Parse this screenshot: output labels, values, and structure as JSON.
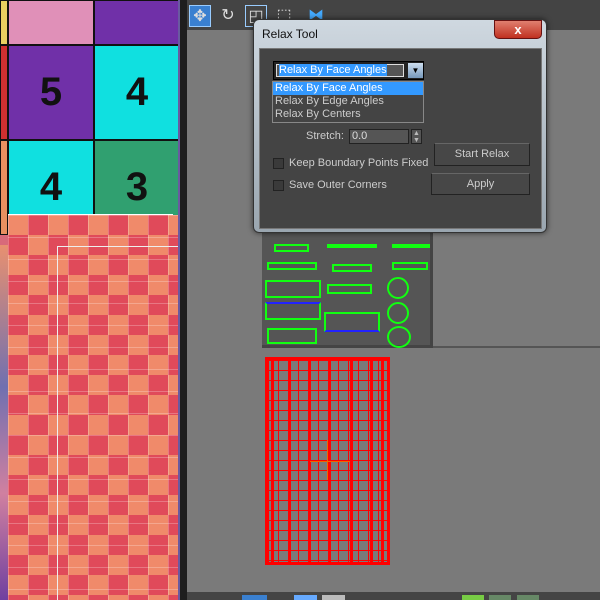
{
  "viewport": {
    "numbers": [
      "5",
      "4",
      "4",
      "3"
    ]
  },
  "dialog": {
    "title": "Relax Tool",
    "close_label": "x",
    "method_select": {
      "value": "Relax By Face Angles",
      "options": [
        "Relax By Face Angles",
        "Relax By Edge Angles",
        "Relax By Centers"
      ],
      "selected_index": 0
    },
    "stretch_label": "Stretch:",
    "stretch_value": "0.0",
    "keep_boundary_label": "Keep Boundary Points Fixed",
    "keep_boundary_checked": false,
    "save_corners_label": "Save Outer Corners",
    "save_corners_checked": false,
    "start_relax_label": "Start Relax",
    "apply_label": "Apply"
  },
  "toolbar": {
    "icons": [
      "move-icon",
      "rotate-icon",
      "scale-icon",
      "freeform-icon",
      "mirror-icon"
    ]
  },
  "colors": {
    "selection": "#ff0000",
    "uv_edges": "#22ff22",
    "highlight": "#3399ff"
  }
}
